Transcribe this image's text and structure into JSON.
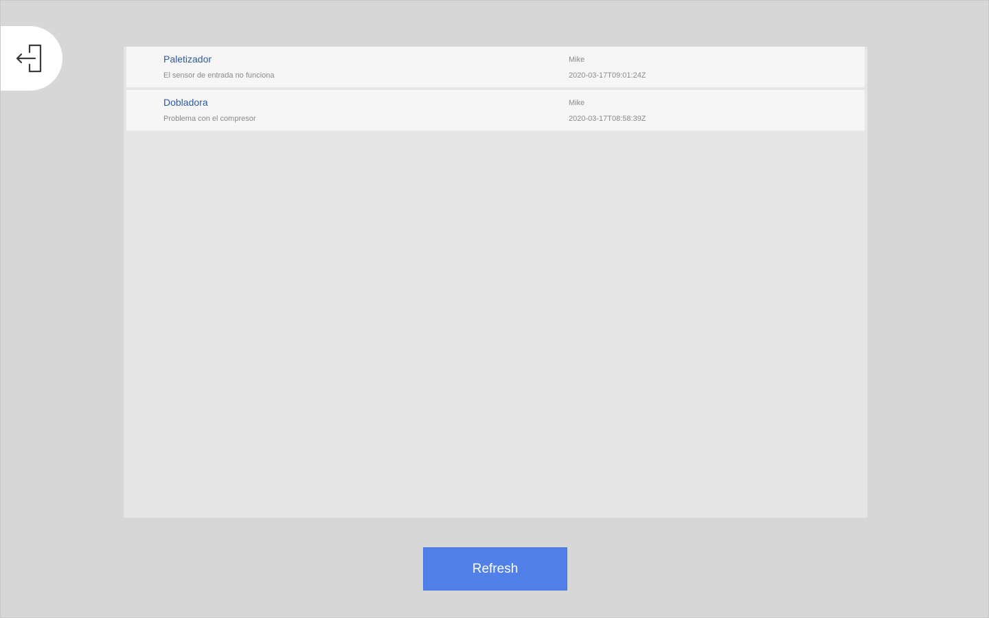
{
  "header": {
    "exit_icon": "logout-icon"
  },
  "list": {
    "items": [
      {
        "title": "Paletizador",
        "description": "El sensor de entrada no funciona",
        "user": "Mike",
        "date": "2020-03-17T09:01:24Z"
      },
      {
        "title": "Dobladora",
        "description": "Problema con el compresor",
        "user": "Mike",
        "date": "2020-03-17T08:58:39Z"
      }
    ]
  },
  "footer": {
    "refresh_label": "Refresh"
  },
  "colors": {
    "background": "#d7d7d7",
    "panel": "#e6e6e6",
    "item_background": "#f6f6f6",
    "title_text": "#2c5aa0",
    "accent_button": "#5181e8"
  }
}
